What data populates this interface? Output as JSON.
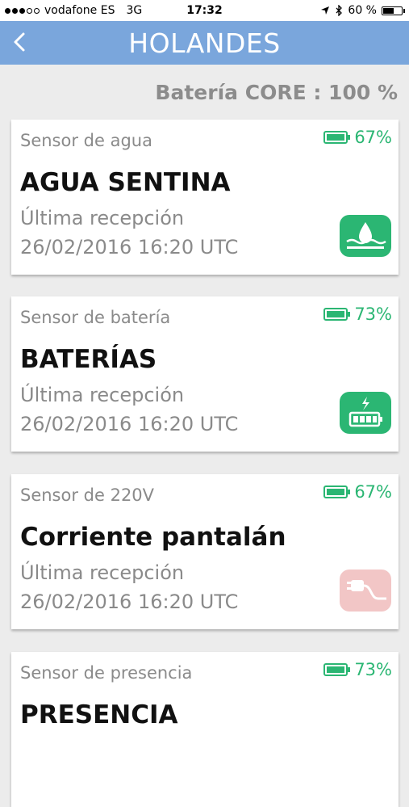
{
  "status": {
    "carrier": "vodafone ES",
    "network": "3G",
    "time": "17:32",
    "battery": "60 %",
    "battery_level": 0.6,
    "icons": [
      "location-icon",
      "bluetooth-icon",
      "battery-icon"
    ]
  },
  "header": {
    "title": "HOLANDES",
    "back_icon": "chevron-left-icon"
  },
  "core_battery": "Batería CORE : 100 %",
  "colors": {
    "accent": "#7aa6dc",
    "ok": "#2bb673",
    "inactive": "#f2c6c6"
  },
  "cards": [
    {
      "type": "Sensor de agua",
      "level": "67%",
      "name": "AGUA SENTINA",
      "recv_label": "Última recepción",
      "date": "26/02/2016 16:20 UTC",
      "icon": "water-drop-icon"
    },
    {
      "type": "Sensor de batería",
      "level": "73%",
      "name": "BATERÍAS",
      "recv_label": "Última recepción",
      "date": "26/02/2016 16:20 UTC",
      "icon": "charging-battery-icon"
    },
    {
      "type": "Sensor de 220V",
      "level": "67%",
      "name": "Corriente pantalán",
      "recv_label": "Última recepción",
      "date": "26/02/2016 16:20 UTC",
      "icon": "power-plug-icon"
    },
    {
      "type": "Sensor de presencia",
      "level": "73%",
      "name": "PRESENCIA"
    }
  ]
}
